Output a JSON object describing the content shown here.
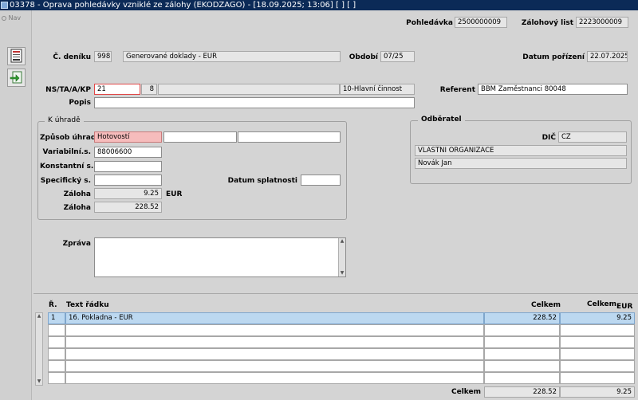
{
  "window": {
    "title": "03378 - Oprava pohledávky vzniklé ze zálohy (EKODZAGO) - [18.09.2025; 13:06]  [ ]  [ ]"
  },
  "sidebar": {
    "nav_label": "Nav"
  },
  "header": {
    "pohledavka_label": "Pohledávka",
    "pohledavka_value": "2500000009",
    "zalohovy_list_label": "Zálohový list",
    "zalohovy_list_value": "2223000009"
  },
  "doc": {
    "cislo_deniku_label": "Č. deníku",
    "cislo_deniku_value": "998",
    "denik_name": "Generované doklady - EUR",
    "obdobi_label": "Období",
    "obdobi_value": "07/25",
    "datum_porizeni_label": "Datum pořízení",
    "datum_porizeni_value": "22.07.2025",
    "ns_label": "NS/TA/A/KP",
    "ns_value": "21",
    "ta_value": "8",
    "a_value": "",
    "kp_value": "10-Hlavní činnost",
    "referent_label": "Referent",
    "referent_value": "BBM Zaměstnanci 80048",
    "popis_label": "Popis",
    "popis_value": ""
  },
  "k_uhrade": {
    "title": "K úhradě",
    "zpusob_label": "Způsob úhrady",
    "zpusob_value": "Hotovostí",
    "zpusob_value2": "",
    "zpusob_value3": "",
    "vs_label": "Variabilní.s.",
    "vs_value": "88006600",
    "ks_label": "Konstantní s.",
    "ks_value": "",
    "ss_label": "Specifický s.",
    "ss_value": "",
    "datum_splatnosti_label": "Datum splatnosti",
    "datum_splatnosti_value": "",
    "zaloha_label": "Záloha",
    "zaloha_value": "9.25",
    "zaloha_currency": "EUR",
    "zaloha2_label": "Záloha",
    "zaloha2_value": "228.52"
  },
  "odberatel": {
    "title": "Odběratel",
    "dic_label": "DIČ",
    "dic_value": "CZ",
    "name": "VLASTNI ORGANIZACE",
    "contact": "Novák Jan"
  },
  "zprava": {
    "label": "Zpráva",
    "value": ""
  },
  "grid": {
    "col_r": "Ř.",
    "col_text": "Text řádku",
    "col_celkem": "Celkem",
    "col_celkem_eur": "Celkem",
    "col_eur": "EUR",
    "rows": [
      {
        "r": "1",
        "text": "16. Pokladna - EUR",
        "celkem": "228.52",
        "celkem_eur": "9.25"
      }
    ],
    "footer_label": "Celkem",
    "footer_celkem": "228.52",
    "footer_celkem_eur": "9.25"
  },
  "colors": {
    "titlebar": "#0b2a57",
    "required": "#f6bcbc",
    "selected_row": "#bcd8f0"
  },
  "icons": [
    "app-icon",
    "save-doc-icon",
    "export-icon",
    "scroll-up-icon",
    "scroll-down-icon"
  ]
}
